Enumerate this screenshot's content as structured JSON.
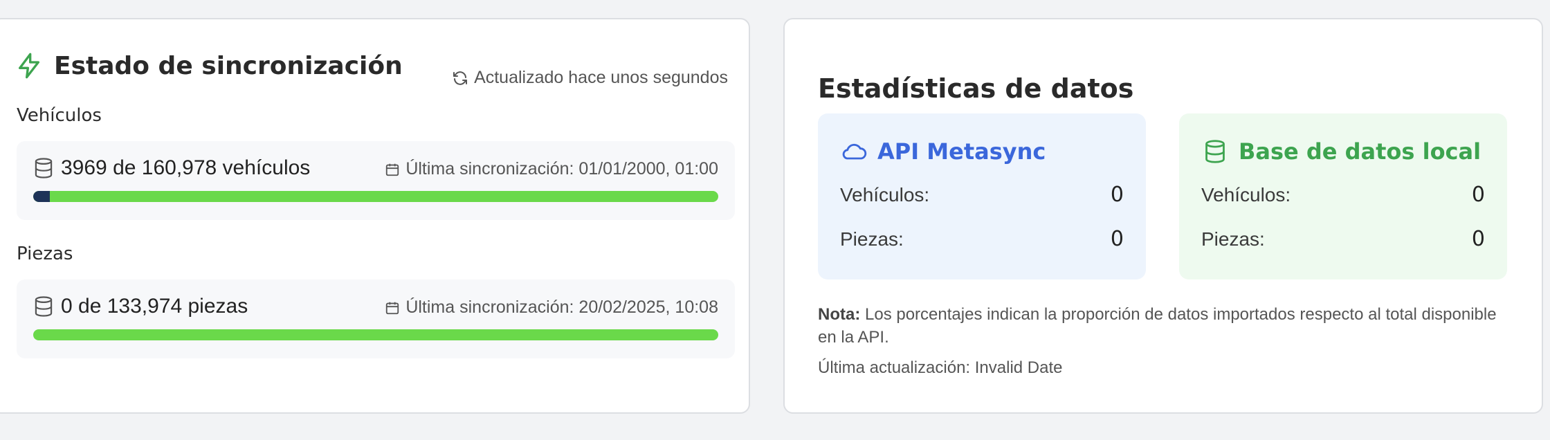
{
  "sync": {
    "title": "Estado de sincronización",
    "updated": "Actualizado hace unos segundos",
    "vehicles": {
      "label": "Vehículos",
      "count": "3969 de 160,978 vehículos",
      "last_sync": "Última sincronización: 01/01/2000, 01:00",
      "progress": 0.0247
    },
    "parts": {
      "label": "Piezas",
      "count": "0 de 133,974 piezas",
      "last_sync": "Última sincronización: 20/02/2025, 10:08",
      "progress": 0
    }
  },
  "stats": {
    "title": "Estadísticas de datos",
    "api": {
      "title": "API Metasync",
      "vehicles_label": "Vehículos:",
      "vehicles_value": "0",
      "parts_label": "Piezas:",
      "parts_value": "0"
    },
    "local": {
      "title": "Base de datos local",
      "vehicles_label": "Vehículos:",
      "vehicles_value": "0",
      "parts_label": "Piezas:",
      "parts_value": "0"
    },
    "note_prefix": "Nota:",
    "note_text": " Los porcentajes indican la proporción de datos importados respecto al total disponible en la API.",
    "last_update": "Última actualización: Invalid Date"
  },
  "colors": {
    "progress_fill": "#1e3358",
    "progress_track": "#6ad94a",
    "api_accent": "#3b67db",
    "local_accent": "#3da44f"
  },
  "icons": {
    "sync_title": "bolt-icon",
    "updated": "refresh-icon",
    "count": "database-icon",
    "last_sync": "calendar-icon",
    "api": "cloud-icon",
    "local": "database-icon"
  }
}
